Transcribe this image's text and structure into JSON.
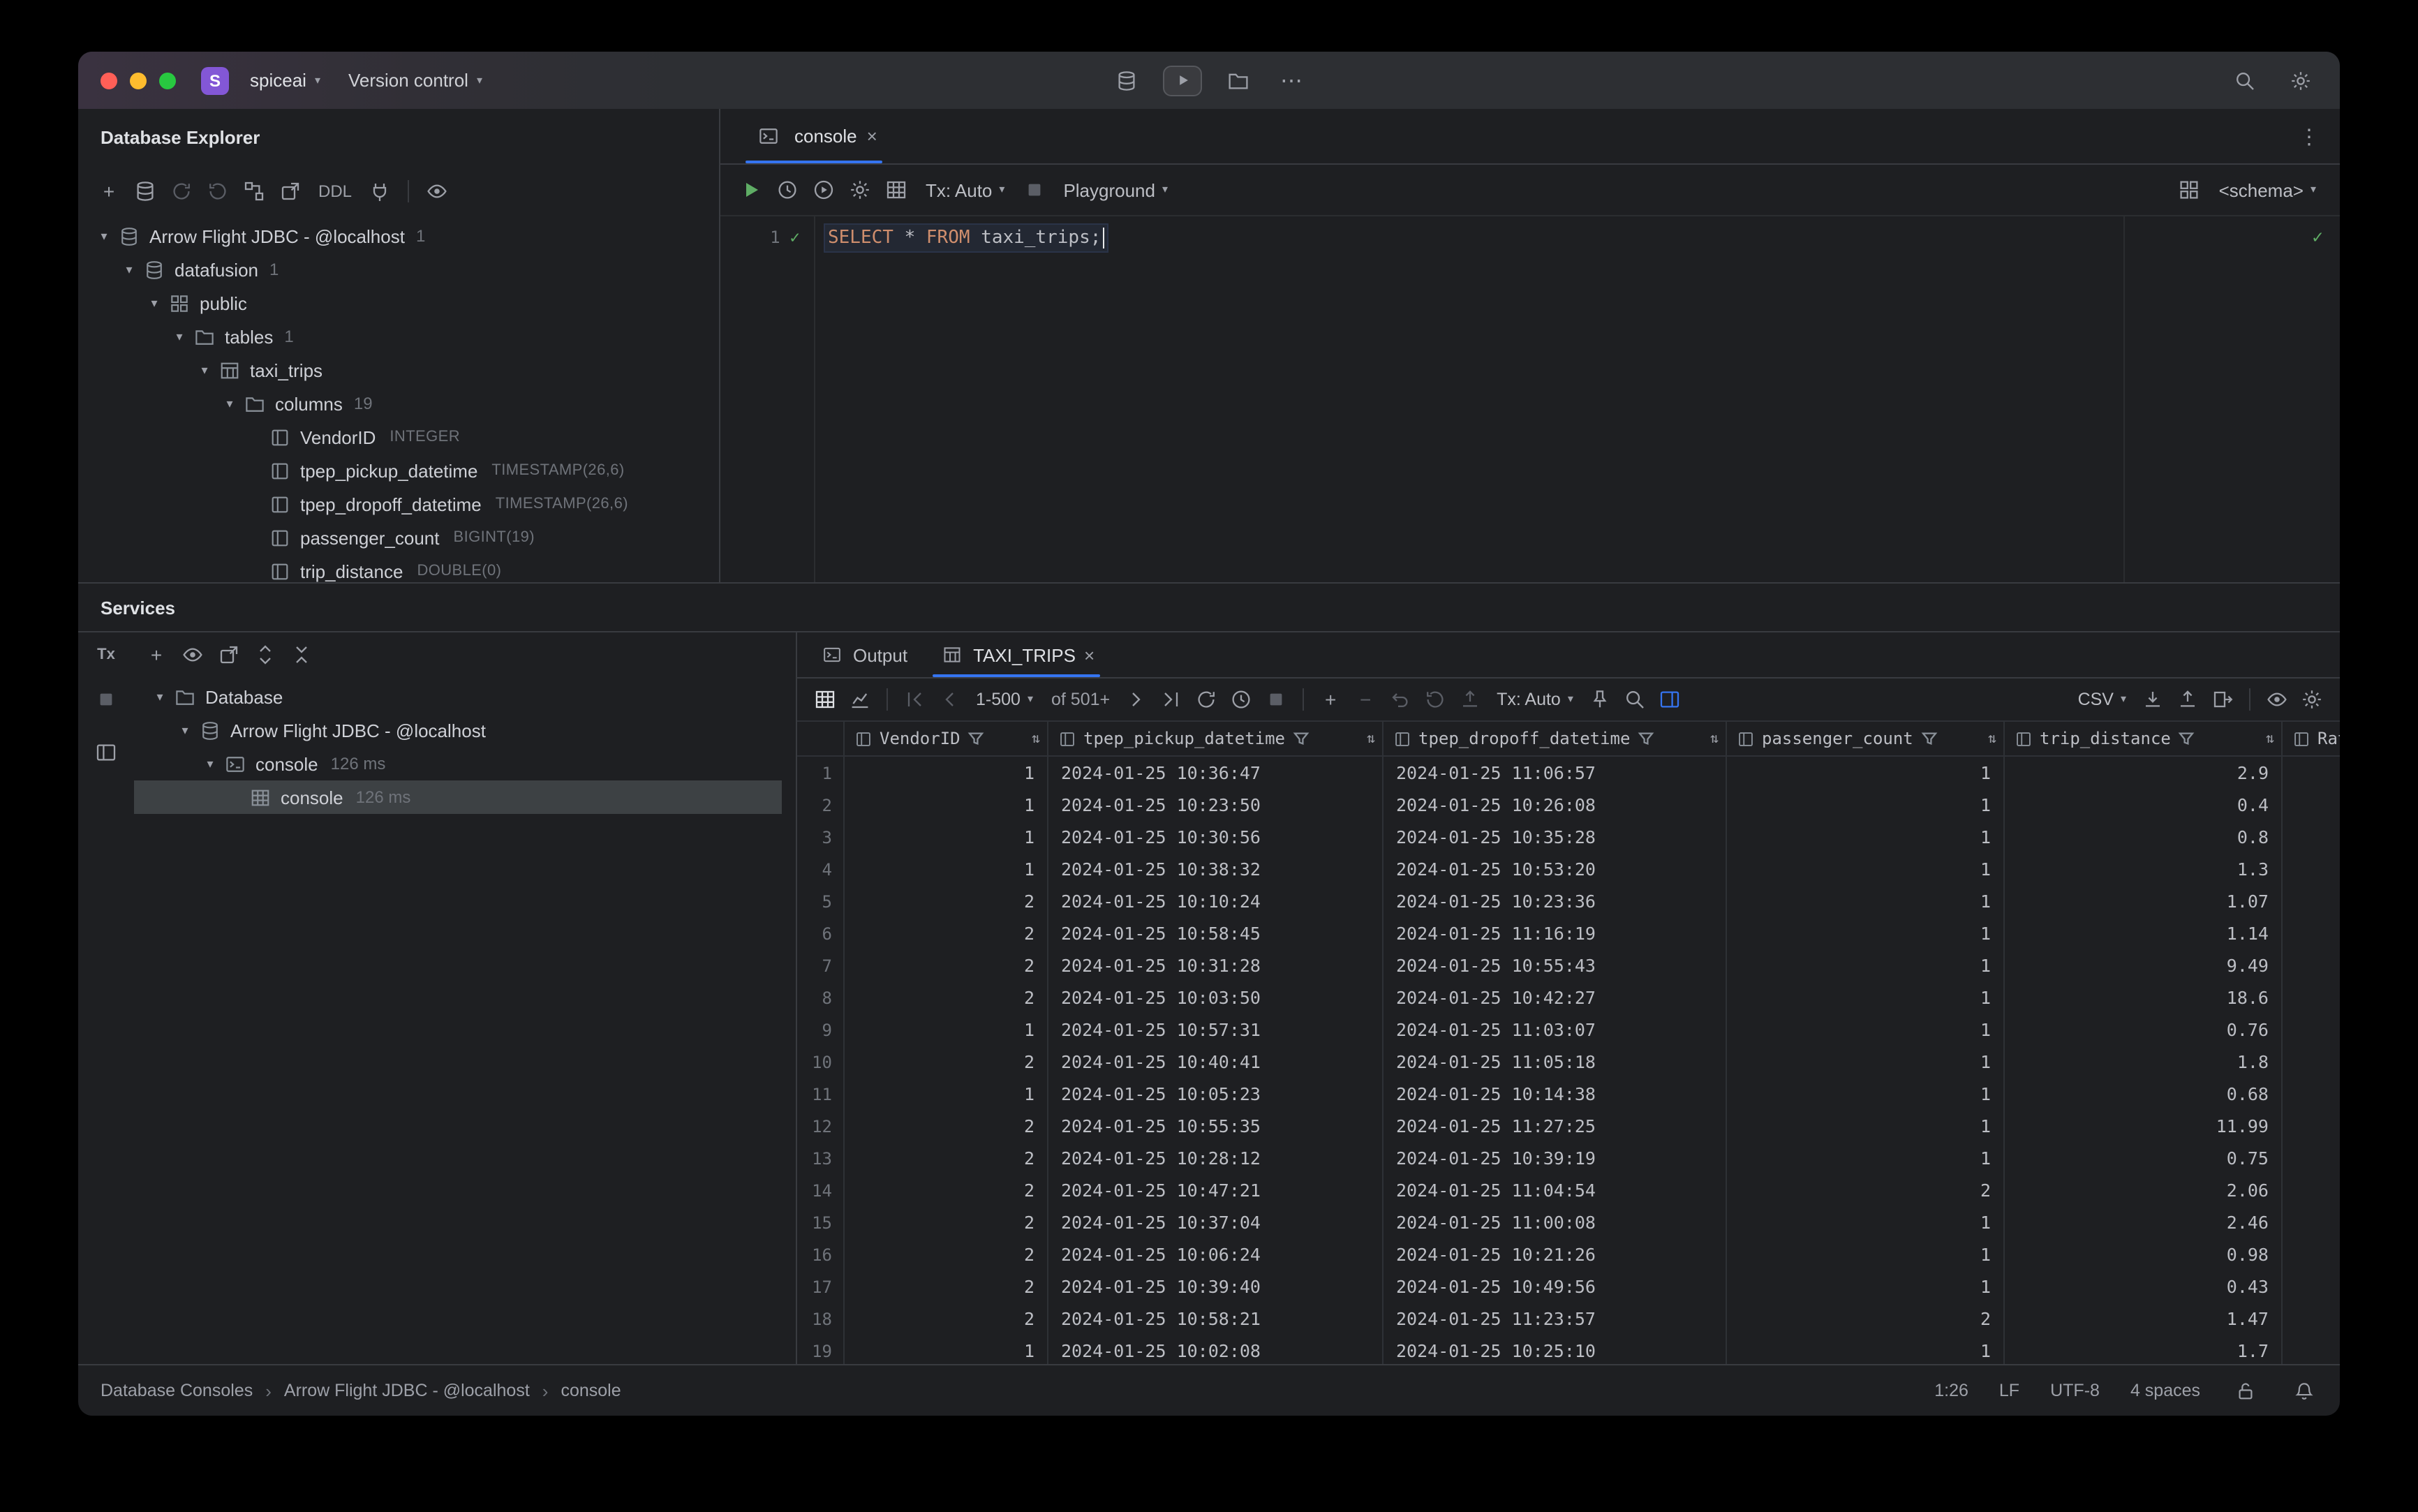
{
  "icons": {
    "chevron_expanded": "▾",
    "chevron_collapsed": "▸",
    "dropdown": "▾",
    "more_horizontal": "⋯",
    "more_vertical": "⋮",
    "close": "×",
    "check": "✓",
    "sort": "⇅",
    "plus": "+",
    "minus": "−",
    "tx": "Tx",
    "breadcrumb_sep": "›"
  },
  "titlebar": {
    "logo_letter": "S",
    "project": "spiceai",
    "version_control": "Version control"
  },
  "database_explorer": {
    "title": "Database Explorer",
    "ddl_button": "DDL",
    "tree": [
      {
        "depth": 0,
        "expanded": true,
        "icon": "database",
        "label": "Arrow Flight JDBC - @localhost",
        "badge": "1"
      },
      {
        "depth": 1,
        "expanded": true,
        "icon": "database",
        "label": "datafusion",
        "badge": "1"
      },
      {
        "depth": 2,
        "expanded": true,
        "icon": "schema-grid",
        "label": "public"
      },
      {
        "depth": 3,
        "expanded": true,
        "icon": "folder",
        "label": "tables",
        "badge": "1"
      },
      {
        "depth": 4,
        "expanded": true,
        "icon": "table",
        "label": "taxi_trips"
      },
      {
        "depth": 5,
        "expanded": true,
        "icon": "folder",
        "label": "columns",
        "badge": "19"
      },
      {
        "depth": 6,
        "icon": "column",
        "label": "VendorID",
        "type": "INTEGER"
      },
      {
        "depth": 6,
        "icon": "column",
        "label": "tpep_pickup_datetime",
        "type": "TIMESTAMP(26,6)"
      },
      {
        "depth": 6,
        "icon": "column",
        "label": "tpep_dropoff_datetime",
        "type": "TIMESTAMP(26,6)"
      },
      {
        "depth": 6,
        "icon": "column",
        "label": "passenger_count",
        "type": "BIGINT(19)"
      },
      {
        "depth": 6,
        "icon": "column",
        "label": "trip_distance",
        "type": "DOUBLE(0)"
      }
    ]
  },
  "editor": {
    "tab_label": "console",
    "toolbar": {
      "tx": "Tx: Auto",
      "playground": "Playground",
      "schema": "<schema>"
    },
    "line_number": "1",
    "sql_tokens": [
      {
        "text": "SELECT ",
        "type": "keyword"
      },
      {
        "text": "* ",
        "type": "operator"
      },
      {
        "text": "FROM ",
        "type": "keyword"
      },
      {
        "text": "taxi_trips",
        "type": "identifier"
      },
      {
        "text": ";",
        "type": "punctuation"
      }
    ]
  },
  "services": {
    "title": "Services",
    "tree": [
      {
        "depth": 0,
        "expanded": true,
        "icon": "folder",
        "label": "Database"
      },
      {
        "depth": 1,
        "expanded": true,
        "icon": "database",
        "label": "Arrow Flight JDBC - @localhost"
      },
      {
        "depth": 2,
        "expanded": true,
        "icon": "terminal",
        "label": "console",
        "time": "126 ms"
      },
      {
        "depth": 3,
        "icon": "grid",
        "label": "console",
        "time": "126 ms",
        "selected": true
      }
    ]
  },
  "results": {
    "tabs": [
      {
        "label": "Output"
      },
      {
        "label": "TAXI_TRIPS",
        "active": true
      }
    ],
    "pagination": {
      "range": "1-500",
      "of_total": "of 501+"
    },
    "tx": "Tx: Auto",
    "export_format": "CSV",
    "grid": {
      "columns": [
        "VendorID",
        "tpep_pickup_datetime",
        "tpep_dropoff_datetime",
        "passenger_count",
        "trip_distance",
        "Rate"
      ],
      "rows": [
        [
          "1",
          "2024-01-25 10:36:47",
          "2024-01-25 11:06:57",
          "1",
          "2.9"
        ],
        [
          "1",
          "2024-01-25 10:23:50",
          "2024-01-25 10:26:08",
          "1",
          "0.4"
        ],
        [
          "1",
          "2024-01-25 10:30:56",
          "2024-01-25 10:35:28",
          "1",
          "0.8"
        ],
        [
          "1",
          "2024-01-25 10:38:32",
          "2024-01-25 10:53:20",
          "1",
          "1.3"
        ],
        [
          "2",
          "2024-01-25 10:10:24",
          "2024-01-25 10:23:36",
          "1",
          "1.07"
        ],
        [
          "2",
          "2024-01-25 10:58:45",
          "2024-01-25 11:16:19",
          "1",
          "1.14"
        ],
        [
          "2",
          "2024-01-25 10:31:28",
          "2024-01-25 10:55:43",
          "1",
          "9.49"
        ],
        [
          "2",
          "2024-01-25 10:03:50",
          "2024-01-25 10:42:27",
          "1",
          "18.6"
        ],
        [
          "1",
          "2024-01-25 10:57:31",
          "2024-01-25 11:03:07",
          "1",
          "0.76"
        ],
        [
          "2",
          "2024-01-25 10:40:41",
          "2024-01-25 11:05:18",
          "1",
          "1.8"
        ],
        [
          "1",
          "2024-01-25 10:05:23",
          "2024-01-25 10:14:38",
          "1",
          "0.68"
        ],
        [
          "2",
          "2024-01-25 10:55:35",
          "2024-01-25 11:27:25",
          "1",
          "11.99"
        ],
        [
          "2",
          "2024-01-25 10:28:12",
          "2024-01-25 10:39:19",
          "1",
          "0.75"
        ],
        [
          "2",
          "2024-01-25 10:47:21",
          "2024-01-25 11:04:54",
          "2",
          "2.06"
        ],
        [
          "2",
          "2024-01-25 10:37:04",
          "2024-01-25 11:00:08",
          "1",
          "2.46"
        ],
        [
          "2",
          "2024-01-25 10:06:24",
          "2024-01-25 10:21:26",
          "1",
          "0.98"
        ],
        [
          "2",
          "2024-01-25 10:39:40",
          "2024-01-25 10:49:56",
          "1",
          "0.43"
        ],
        [
          "2",
          "2024-01-25 10:58:21",
          "2024-01-25 11:23:57",
          "2",
          "1.47"
        ],
        [
          "1",
          "2024-01-25 10:02:08",
          "2024-01-25 10:25:10",
          "1",
          "1.7"
        ]
      ]
    }
  },
  "statusbar": {
    "breadcrumbs": [
      "Database Consoles",
      "Arrow Flight JDBC - @localhost",
      "console"
    ],
    "caret_position": "1:26",
    "line_separator": "LF",
    "encoding": "UTF-8",
    "indent": "4 spaces"
  }
}
